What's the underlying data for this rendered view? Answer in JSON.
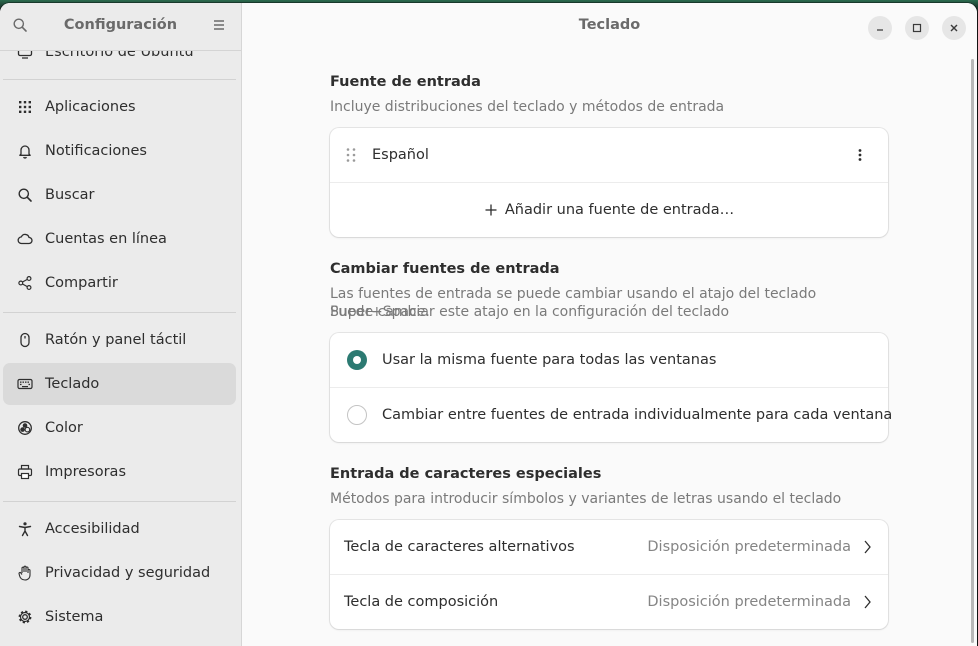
{
  "sidebar": {
    "title": "Configuración",
    "items": [
      {
        "label": "Escritorio de Ubuntu",
        "icon": "desktop-icon"
      },
      {
        "label": "Aplicaciones",
        "icon": "apps-grid-icon"
      },
      {
        "label": "Notificaciones",
        "icon": "bell-icon"
      },
      {
        "label": "Buscar",
        "icon": "search-icon"
      },
      {
        "label": "Cuentas en línea",
        "icon": "cloud-icon"
      },
      {
        "label": "Compartir",
        "icon": "share-icon"
      },
      {
        "label": "Ratón y panel táctil",
        "icon": "mouse-icon"
      },
      {
        "label": "Teclado",
        "icon": "keyboard-icon",
        "selected": true
      },
      {
        "label": "Color",
        "icon": "color-palette-icon"
      },
      {
        "label": "Impresoras",
        "icon": "printer-icon"
      },
      {
        "label": "Accesibilidad",
        "icon": "accessibility-icon"
      },
      {
        "label": "Privacidad y seguridad",
        "icon": "hand-icon"
      },
      {
        "label": "Sistema",
        "icon": "gear-icon"
      }
    ]
  },
  "main": {
    "title": "Teclado",
    "input_sources": {
      "title": "Fuente de entrada",
      "subtitle": "Incluye distribuciones del teclado y métodos de entrada",
      "source": "Español",
      "add_label": "Añadir una fuente de entrada…"
    },
    "switch_sources": {
      "title": "Cambiar fuentes de entrada",
      "subtitle_line1": "Las fuentes de entrada se puede cambiar usando el atajo del teclado Super+Space.",
      "subtitle_line2": "Puede cambiar este atajo en la configuración del teclado",
      "option_same": "Usar la misma fuente para todas las ventanas",
      "option_individual": "Cambiar entre fuentes de entrada individualmente para cada ventana",
      "selected": "same"
    },
    "special_chars": {
      "title": "Entrada de caracteres especiales",
      "subtitle": "Métodos para introducir símbolos y variantes de letras usando el teclado",
      "rows": [
        {
          "label": "Tecla de caracteres alternativos",
          "value": "Disposición predeterminada"
        },
        {
          "label": "Tecla de composición",
          "value": "Disposición predeterminada"
        }
      ]
    }
  },
  "colors": {
    "accent": "#2c7a72",
    "sidebar_bg": "#ebebeb",
    "selected_bg": "#dadada"
  }
}
